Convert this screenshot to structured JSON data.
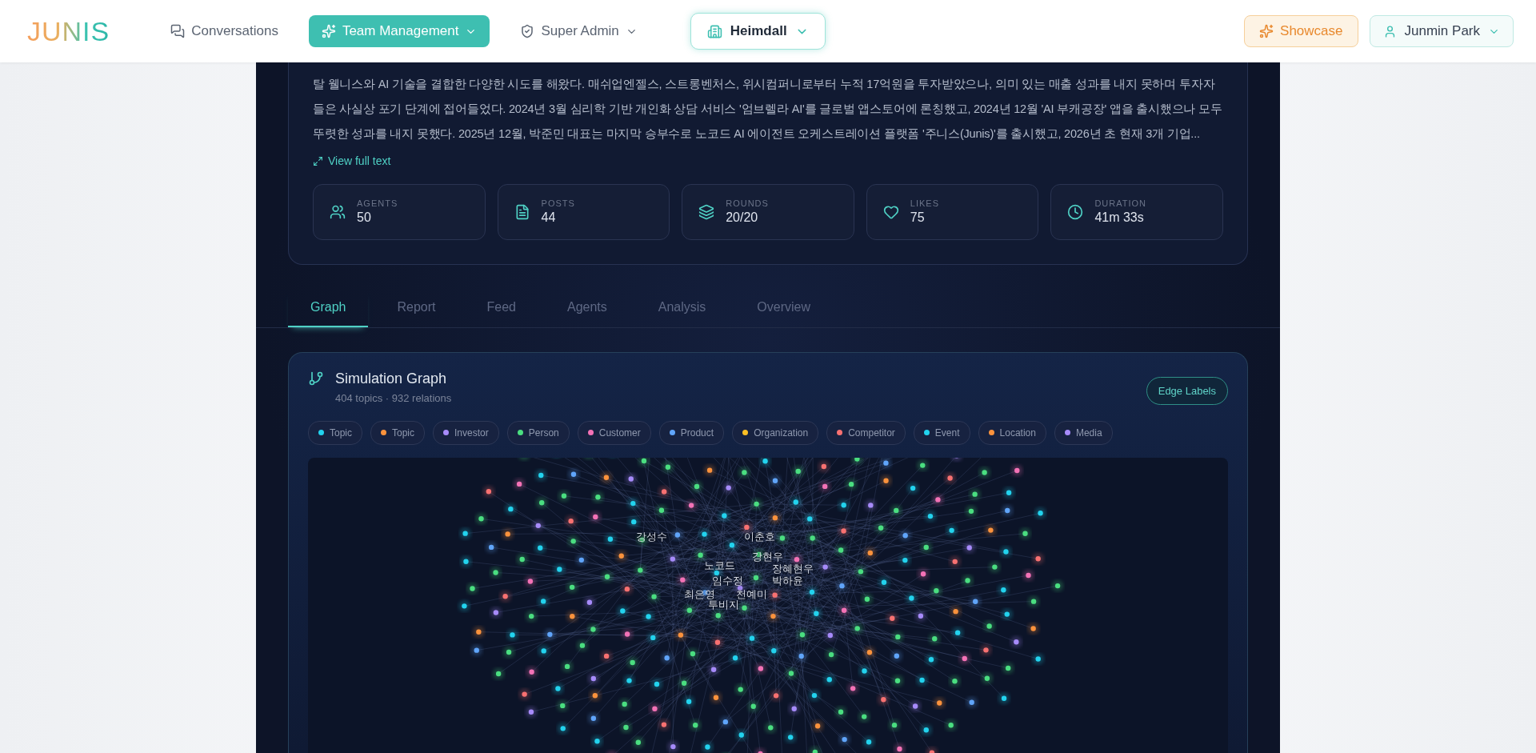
{
  "header": {
    "logo": "JUNIS",
    "nav": [
      {
        "label": "Conversations",
        "selected": false,
        "dropdown": false
      },
      {
        "label": "Team Management",
        "selected": true,
        "dropdown": true
      },
      {
        "label": "Super Admin",
        "selected": false,
        "dropdown": true
      }
    ],
    "workspace": "Heimdall",
    "showcase": "Showcase",
    "user": "Junmin Park"
  },
  "summary": {
    "text": "탈 웰니스와 AI 기술을 결합한 다양한 시도를 해왔다. 매쉬업엔젤스, 스트롱벤처스, 위시컴퍼니로부터 누적 17억원을 투자받았으나, 의미 있는 매출 성과를 내지 못하며 투자자들은 사실상 포기 단계에 접어들었다. 2024년 3월 심리학 기반 개인화 상담 서비스 '엄브렐라 AI'를 글로벌 앱스토어에 론칭했고, 2024년 12월 'AI 부캐공장' 앱을 출시했으나 모두 뚜렷한 성과를 내지 못했다. 2025년 12월, 박준민 대표는 마지막 승부수로 노코드 AI 에이전트 오케스트레이션 플랫폼 '주니스(Junis)'를 출시했고, 2026년 초 현재 3개 기업...",
    "link": "View full text"
  },
  "stats": [
    {
      "label": "AGENTS",
      "value": "50"
    },
    {
      "label": "POSTS",
      "value": "44"
    },
    {
      "label": "ROUNDS",
      "value": "20/20"
    },
    {
      "label": "LIKES",
      "value": "75"
    },
    {
      "label": "DURATION",
      "value": "41m 33s"
    }
  ],
  "tabs": [
    {
      "label": "Graph",
      "selected": true
    },
    {
      "label": "Report",
      "selected": false
    },
    {
      "label": "Feed",
      "selected": false
    },
    {
      "label": "Agents",
      "selected": false
    },
    {
      "label": "Analysis",
      "selected": false
    },
    {
      "label": "Overview",
      "selected": false
    }
  ],
  "graph": {
    "title": "Simulation Graph",
    "subtitle": "404 topics · 932 relations",
    "edge_labels_button": "Edge Labels",
    "legend": [
      {
        "label": "Topic",
        "color": "#22d3ee"
      },
      {
        "label": "Topic",
        "color": "#fb923c"
      },
      {
        "label": "Investor",
        "color": "#a78bfa"
      },
      {
        "label": "Person",
        "color": "#4ade80"
      },
      {
        "label": "Customer",
        "color": "#f472b6"
      },
      {
        "label": "Product",
        "color": "#60a5fa"
      },
      {
        "label": "Organization",
        "color": "#fbbf24"
      },
      {
        "label": "Competitor",
        "color": "#f87171"
      },
      {
        "label": "Event",
        "color": "#22d3ee"
      },
      {
        "label": "Location",
        "color": "#fb923c"
      },
      {
        "label": "Media",
        "color": "#a78bfa"
      }
    ],
    "node_labels": [
      "강성수",
      "이춘호",
      "강현우",
      "노코드",
      "장혜현우",
      "임수정",
      "박하윤",
      "최은영",
      "천예미",
      "투비지"
    ]
  }
}
